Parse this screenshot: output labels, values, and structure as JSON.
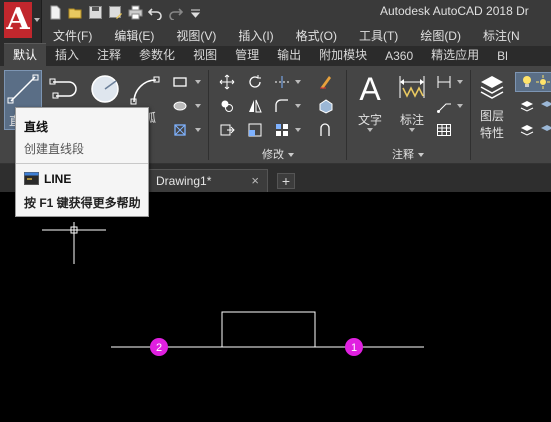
{
  "window": {
    "app_title": "Autodesk AutoCAD 2018   Dr"
  },
  "app_menu": {
    "logo_letter": "A"
  },
  "quick_access": {
    "icons": [
      "new-icon",
      "open-icon",
      "save-icon",
      "save-as-icon",
      "print-icon",
      "undo-icon",
      "redo-icon",
      "customize-icon"
    ]
  },
  "menubar": {
    "items": [
      "文件(F)",
      "编辑(E)",
      "视图(V)",
      "插入(I)",
      "格式(O)",
      "工具(T)",
      "绘图(D)",
      "标注(N"
    ]
  },
  "ribbon_tabs": {
    "items": [
      "默认",
      "插入",
      "注释",
      "参数化",
      "视图",
      "管理",
      "输出",
      "附加模块",
      "A360",
      "精选应用",
      "Bl"
    ],
    "active": "默认"
  },
  "ribbon": {
    "draw_partial_labels": [
      "直",
      "弧"
    ],
    "modify_label": "修改",
    "annotation_label": "注释",
    "text_label": "文字",
    "dimension_label": "标注",
    "layer_props_label_1": "图层",
    "layer_props_label_2": "特性"
  },
  "document": {
    "tab_name": "Drawing1*",
    "close_glyph": "×",
    "new_tab_glyph": "+"
  },
  "tooltip": {
    "title": "直线",
    "description": "创建直线段",
    "command": "LINE",
    "help": "按 F1 键获得更多帮助"
  },
  "canvas": {
    "markers": [
      "2",
      "1"
    ],
    "marker_color": "#e020e0",
    "line_color": "#ffffff"
  },
  "colors": {
    "accent_red": "#c1272d",
    "ribbon_bg": "#454545",
    "title_bg": "#3a3a3a"
  }
}
